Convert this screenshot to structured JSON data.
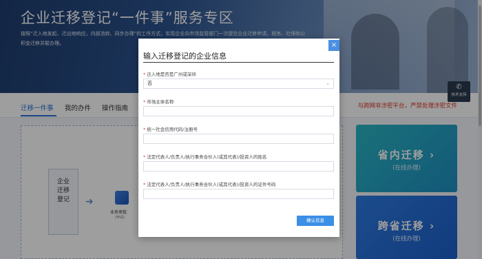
{
  "banner": {
    "title": "企业迁移登记“一件事”服务专区",
    "description": "按照“迁入地发起、迁出地响应，内部流转、同步办理”的工作方式，实现企业向市场监管部门一次提交企业迁移申请，税务、社保和公积金迁移并联办理。"
  },
  "tabs": {
    "items": [
      {
        "label": "迁移一件事"
      },
      {
        "label": "我的办件"
      },
      {
        "label": "操作指南"
      }
    ],
    "notice": "与跨网非涉密平台，严禁处理涉密文件"
  },
  "flow": {
    "step_label": "企业迁移登记",
    "audit_label": "业务审批",
    "audit_sub": "(申请)"
  },
  "cards": [
    {
      "title": "省内迁移 ›",
      "subtitle": "(在线办理)"
    },
    {
      "title": "跨省迁移 ›",
      "subtitle": "(在线办理)"
    }
  ],
  "contact": {
    "icon": "phone-icon",
    "label": "技术支持"
  },
  "modal": {
    "title": "输入迁移登记的企业信息",
    "close_icon": "×",
    "fields": [
      {
        "label": "迁入地是否是广州或深圳",
        "value": "否",
        "placeholder": ""
      },
      {
        "label": "市场主体名称",
        "value": "",
        "placeholder": ""
      },
      {
        "label": "统一社会信用代码/注册号",
        "value": "",
        "placeholder": ""
      },
      {
        "label": "法定代表人/负责人/执行事务合伙人(或其代表)/投资人的姓名",
        "value": "",
        "placeholder": ""
      },
      {
        "label": "法定代表人/负责人/执行事务合伙人(或其代表)/投资人的证件号码",
        "value": "",
        "placeholder": ""
      }
    ],
    "confirm_label": "确认信息"
  },
  "colors": {
    "accent": "#3b8fe6",
    "required": "#e0352b",
    "card1": "#2ab7c4",
    "card2": "#2e7be2"
  }
}
